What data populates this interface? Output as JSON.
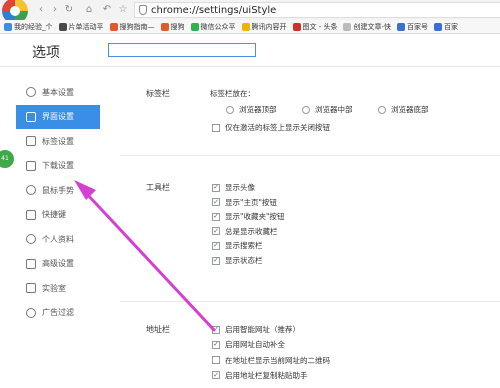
{
  "toolbar": {
    "back_icon": "back-arrow-icon",
    "forward_icon": "forward-arrow-icon",
    "refresh_icon": "refresh-icon",
    "home_icon": "home-icon",
    "undo_icon": "undo-icon",
    "star_icon": "star-icon"
  },
  "address_bar": {
    "url": "chrome://settings/uiStyle"
  },
  "bookmarks": [
    {
      "label": "我的经验_个",
      "color": "#3a8ee6"
    },
    {
      "label": "片单活动平",
      "color": "#4a4a4a"
    },
    {
      "label": "搜狗指南—",
      "color": "#e05a2a"
    },
    {
      "label": "搜狗",
      "color": "#e05a2a"
    },
    {
      "label": "微信公众平",
      "color": "#2db44a"
    },
    {
      "label": "腾讯内容开",
      "color": "#f0b400"
    },
    {
      "label": "图文 - 头条",
      "color": "#d0302a"
    },
    {
      "label": "创建文章-快",
      "color": "#bbbbbb"
    },
    {
      "label": "百家号",
      "color": "#3a6fd8"
    },
    {
      "label": "百家",
      "color": "#3a6fd8"
    }
  ],
  "page": {
    "title": "选项",
    "search_value": ""
  },
  "sidebar": {
    "items": [
      {
        "label": "基本设置"
      },
      {
        "label": "界面设置"
      },
      {
        "label": "标签设置"
      },
      {
        "label": "下载设置"
      },
      {
        "label": "鼠标手势"
      },
      {
        "label": "快捷键"
      },
      {
        "label": "个人资料"
      },
      {
        "label": "高级设置"
      },
      {
        "label": "实验室"
      },
      {
        "label": "广告过滤"
      }
    ]
  },
  "sections": {
    "tabbar": {
      "label": "标签栏",
      "position_label": "标签栏放在：",
      "radios": [
        "浏览器顶部",
        "浏览器中部",
        "浏览器底部"
      ],
      "close_only_active": "仅在激活的标签上显示关闭按钮"
    },
    "toolbar": {
      "label": "工具栏",
      "options": [
        "显示头像",
        "显示\"主页\"按钮",
        "显示\"收藏夹\"按钮",
        "总是显示收藏栏",
        "显示搜索栏",
        "显示状态栏"
      ]
    },
    "addressbar": {
      "label": "地址栏",
      "options": [
        "启用智能网址（推荐）",
        "启用网址自动补全",
        "在地址栏显示当前网址的二维码",
        "启用地址栏复制粘贴助手"
      ]
    }
  },
  "badge": "41",
  "colors": {
    "accent": "#3a8ee6",
    "arrow": "#d43fd4"
  }
}
